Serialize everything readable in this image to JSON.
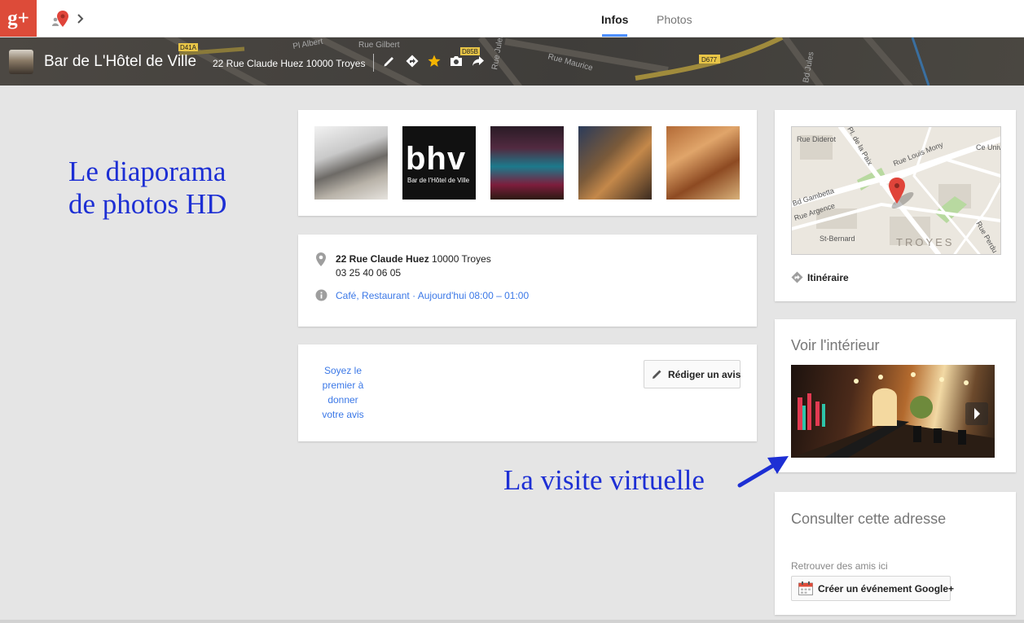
{
  "topbar": {
    "logo_text": "g+",
    "tabs": [
      {
        "label": "Infos",
        "active": true
      },
      {
        "label": "Photos",
        "active": false
      }
    ]
  },
  "header": {
    "place_name": "Bar de L'Hôtel de Ville",
    "address": "22 Rue Claude Huez 10000 Troyes",
    "actions": [
      "pencil-icon",
      "directions-icon",
      "star-icon",
      "camera-icon",
      "share-icon"
    ],
    "map_labels": [
      "Rue Gilbert",
      "Pl Albert",
      "Rue Jules Dido",
      "Rue Maurice",
      "D677",
      "D41A",
      "D85B",
      "Bd Jules"
    ]
  },
  "photos": {
    "bhv_logo": "bhv",
    "bhv_caption": "Bar de l'Hôtel de Ville"
  },
  "info": {
    "street": "22 Rue Claude Huez",
    "city": " 10000 Troyes",
    "phone": "03 25 40 06 05",
    "cat_1": "Café",
    "cat_sep": ", ",
    "cat_2": "Restaurant",
    "hours": " · Aujourd'hui 08:00 – 01:00"
  },
  "review": {
    "prompt": "Soyez le premier à donner votre avis",
    "button_label": "Rédiger un avis"
  },
  "map": {
    "labels": [
      "Rue Diderot",
      "Pl. de la Paix",
      "Rue Louis Mony",
      "Bd Gambetta",
      "Rue Argence",
      "St-Bernard",
      "TROYES",
      "Rue Perdu",
      "Ce Univ de T"
    ],
    "directions_label": "Itinéraire"
  },
  "streetview": {
    "title": "Voir l'intérieur"
  },
  "calendar": {
    "title": "Consulter cette adresse",
    "subtitle": "Retrouver des amis ici",
    "button_label": "Créer un événement Google+"
  },
  "annotations": {
    "photos": "Le diaporama de photos HD",
    "virtual": "La visite virtuelle"
  },
  "colors": {
    "gplus_red": "#dd4b39",
    "link_blue": "#3b78e7",
    "tab_underline": "#4d90fe",
    "annotation_blue": "#1d2fd4",
    "star": "#f4b400"
  }
}
